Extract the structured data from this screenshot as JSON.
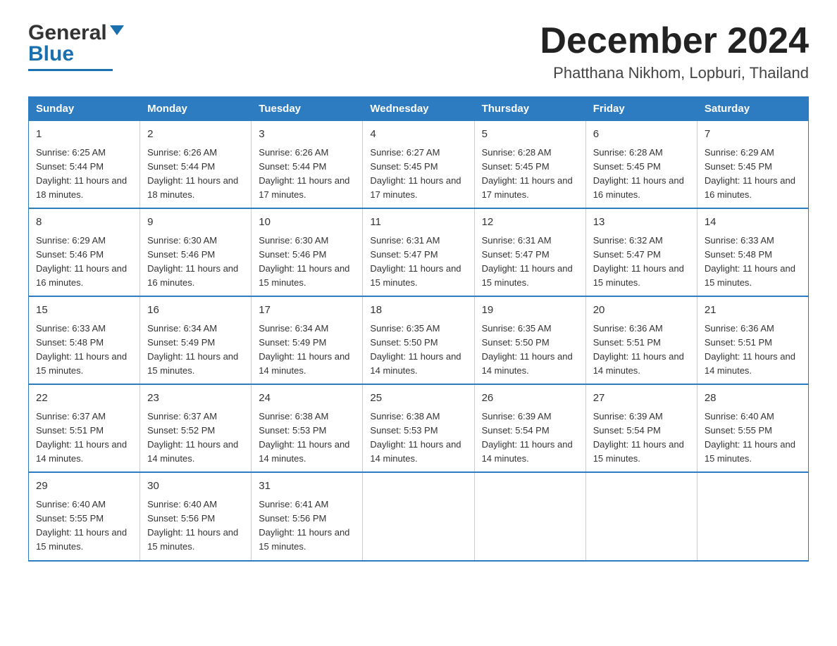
{
  "logo": {
    "general": "General",
    "blue": "Blue"
  },
  "header": {
    "month_title": "December 2024",
    "location": "Phatthana Nikhom, Lopburi, Thailand"
  },
  "weekdays": [
    "Sunday",
    "Monday",
    "Tuesday",
    "Wednesday",
    "Thursday",
    "Friday",
    "Saturday"
  ],
  "weeks": [
    [
      {
        "day": "1",
        "sunrise": "6:25 AM",
        "sunset": "5:44 PM",
        "daylight": "11 hours and 18 minutes."
      },
      {
        "day": "2",
        "sunrise": "6:26 AM",
        "sunset": "5:44 PM",
        "daylight": "11 hours and 18 minutes."
      },
      {
        "day": "3",
        "sunrise": "6:26 AM",
        "sunset": "5:44 PM",
        "daylight": "11 hours and 17 minutes."
      },
      {
        "day": "4",
        "sunrise": "6:27 AM",
        "sunset": "5:45 PM",
        "daylight": "11 hours and 17 minutes."
      },
      {
        "day": "5",
        "sunrise": "6:28 AM",
        "sunset": "5:45 PM",
        "daylight": "11 hours and 17 minutes."
      },
      {
        "day": "6",
        "sunrise": "6:28 AM",
        "sunset": "5:45 PM",
        "daylight": "11 hours and 16 minutes."
      },
      {
        "day": "7",
        "sunrise": "6:29 AM",
        "sunset": "5:45 PM",
        "daylight": "11 hours and 16 minutes."
      }
    ],
    [
      {
        "day": "8",
        "sunrise": "6:29 AM",
        "sunset": "5:46 PM",
        "daylight": "11 hours and 16 minutes."
      },
      {
        "day": "9",
        "sunrise": "6:30 AM",
        "sunset": "5:46 PM",
        "daylight": "11 hours and 16 minutes."
      },
      {
        "day": "10",
        "sunrise": "6:30 AM",
        "sunset": "5:46 PM",
        "daylight": "11 hours and 15 minutes."
      },
      {
        "day": "11",
        "sunrise": "6:31 AM",
        "sunset": "5:47 PM",
        "daylight": "11 hours and 15 minutes."
      },
      {
        "day": "12",
        "sunrise": "6:31 AM",
        "sunset": "5:47 PM",
        "daylight": "11 hours and 15 minutes."
      },
      {
        "day": "13",
        "sunrise": "6:32 AM",
        "sunset": "5:47 PM",
        "daylight": "11 hours and 15 minutes."
      },
      {
        "day": "14",
        "sunrise": "6:33 AM",
        "sunset": "5:48 PM",
        "daylight": "11 hours and 15 minutes."
      }
    ],
    [
      {
        "day": "15",
        "sunrise": "6:33 AM",
        "sunset": "5:48 PM",
        "daylight": "11 hours and 15 minutes."
      },
      {
        "day": "16",
        "sunrise": "6:34 AM",
        "sunset": "5:49 PM",
        "daylight": "11 hours and 15 minutes."
      },
      {
        "day": "17",
        "sunrise": "6:34 AM",
        "sunset": "5:49 PM",
        "daylight": "11 hours and 14 minutes."
      },
      {
        "day": "18",
        "sunrise": "6:35 AM",
        "sunset": "5:50 PM",
        "daylight": "11 hours and 14 minutes."
      },
      {
        "day": "19",
        "sunrise": "6:35 AM",
        "sunset": "5:50 PM",
        "daylight": "11 hours and 14 minutes."
      },
      {
        "day": "20",
        "sunrise": "6:36 AM",
        "sunset": "5:51 PM",
        "daylight": "11 hours and 14 minutes."
      },
      {
        "day": "21",
        "sunrise": "6:36 AM",
        "sunset": "5:51 PM",
        "daylight": "11 hours and 14 minutes."
      }
    ],
    [
      {
        "day": "22",
        "sunrise": "6:37 AM",
        "sunset": "5:51 PM",
        "daylight": "11 hours and 14 minutes."
      },
      {
        "day": "23",
        "sunrise": "6:37 AM",
        "sunset": "5:52 PM",
        "daylight": "11 hours and 14 minutes."
      },
      {
        "day": "24",
        "sunrise": "6:38 AM",
        "sunset": "5:53 PM",
        "daylight": "11 hours and 14 minutes."
      },
      {
        "day": "25",
        "sunrise": "6:38 AM",
        "sunset": "5:53 PM",
        "daylight": "11 hours and 14 minutes."
      },
      {
        "day": "26",
        "sunrise": "6:39 AM",
        "sunset": "5:54 PM",
        "daylight": "11 hours and 14 minutes."
      },
      {
        "day": "27",
        "sunrise": "6:39 AM",
        "sunset": "5:54 PM",
        "daylight": "11 hours and 15 minutes."
      },
      {
        "day": "28",
        "sunrise": "6:40 AM",
        "sunset": "5:55 PM",
        "daylight": "11 hours and 15 minutes."
      }
    ],
    [
      {
        "day": "29",
        "sunrise": "6:40 AM",
        "sunset": "5:55 PM",
        "daylight": "11 hours and 15 minutes."
      },
      {
        "day": "30",
        "sunrise": "6:40 AM",
        "sunset": "5:56 PM",
        "daylight": "11 hours and 15 minutes."
      },
      {
        "day": "31",
        "sunrise": "6:41 AM",
        "sunset": "5:56 PM",
        "daylight": "11 hours and 15 minutes."
      },
      null,
      null,
      null,
      null
    ]
  ]
}
